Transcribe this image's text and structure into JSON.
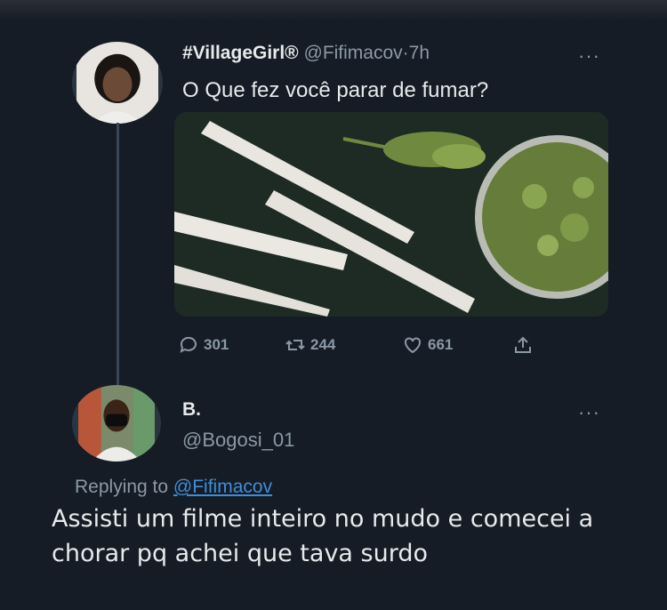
{
  "original_tweet": {
    "display_name": "#VillageGirl®",
    "handle": "@Fifimacov",
    "separator": "·",
    "time": "7h",
    "more_label": "···",
    "text": "O Que fez você parar de fumar?",
    "media_icon": "marijuana-photo",
    "actions": {
      "replies": "301",
      "retweets": "244",
      "likes": "661"
    }
  },
  "reply_tweet": {
    "display_name": "B.",
    "handle": "@Bogosi_01",
    "more_label": "···",
    "replying_prefix": "Replying to",
    "replying_to": "@Fifimacov",
    "text": "Assisti um filme inteiro no mudo e comecei a chorar pq achei que tava surdo"
  },
  "colors": {
    "background": "#151c26",
    "text": "#e7e9ea",
    "muted": "#8b98a5",
    "link": "#3f8fd6"
  }
}
